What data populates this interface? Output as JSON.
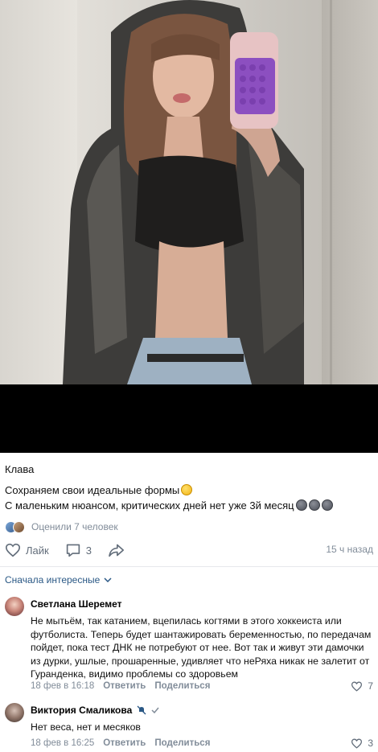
{
  "post": {
    "author": "Клава",
    "text_line1": "Сохраняем свои идеальные формы",
    "text_line2": "С маленьким нюансом, критических дней нет уже 3й месяц",
    "likes_summary": "Оценили 7 человек",
    "like_label": "Лайк",
    "comments_count": "3",
    "time": "15 ч назад"
  },
  "comments_sort": "Сначала интересные",
  "comments": [
    {
      "author": "Светлана Шеремет",
      "text": "Не мытьём, так катанием, вцепилась когтями в этого хоккеиста или футболиста. Теперь будет шантажировать беременностью, по передачам пойдет, пока тест ДНК не потребуют от нее. Вот так и живут эти дамочки из дурки, ушлые, прошаренные, удивляет что неРяха никак не залетит от Гуранденка, видимо проблемы со здоровьем",
      "date": "18 фев в 16:18",
      "reply": "Ответить",
      "share": "Поделиться",
      "likes": "7"
    },
    {
      "author": "Виктория Смаликова",
      "text": "Нет веса, нет и месяков",
      "date": "18 фев в 16:25",
      "reply": "Ответить",
      "share": "Поделиться",
      "likes": "3"
    }
  ],
  "colors": {
    "link": "#2a5885",
    "muted": "#818c99",
    "icon": "#626d7a"
  }
}
